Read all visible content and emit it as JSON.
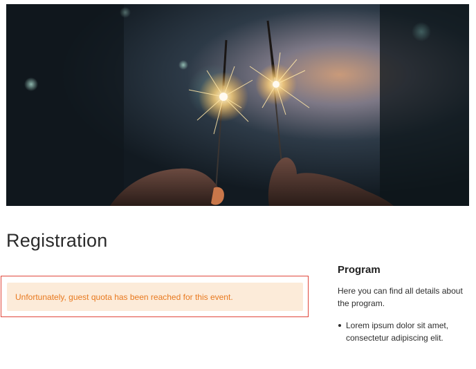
{
  "hero": {
    "icon": "sparklers-photo"
  },
  "page": {
    "title": "Registration"
  },
  "alert": {
    "message": "Unfortunately, guest quota has been reached for this event.",
    "colors": {
      "background": "#fcebd9",
      "text": "#e8791f",
      "highlight_border": "#e0463a"
    }
  },
  "sidebar": {
    "title": "Program",
    "description": "Here you can find all details about the program.",
    "items": [
      {
        "label": "Lorem ipsum dolor sit amet, consectetur adipiscing elit."
      }
    ]
  }
}
